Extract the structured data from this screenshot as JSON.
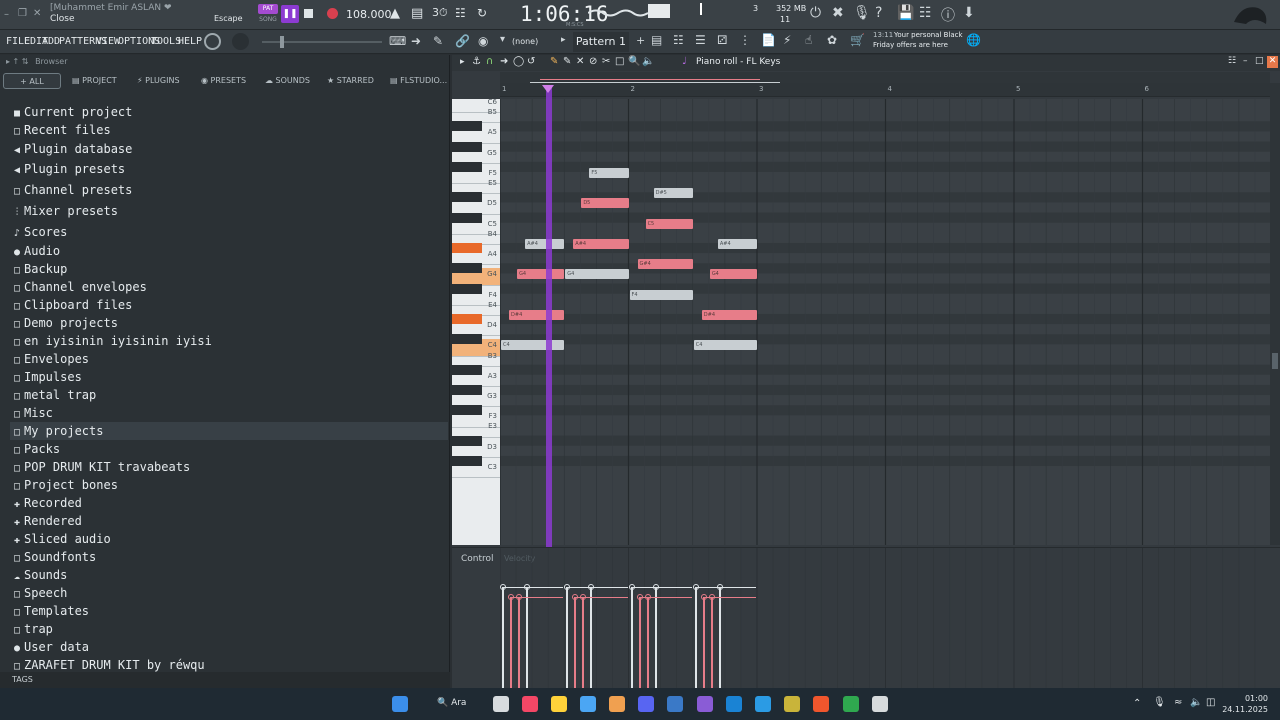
{
  "topbar": {
    "user_title": "[Muhammet Emir ASLAN ❤",
    "close_hint": "Close",
    "escape_hint": "Escape",
    "pat_label": "PAT",
    "song_label": "SONG",
    "tempo": "108.000",
    "time": "1:06:16",
    "time_unit": "M:S:CS",
    "cpu_bars": "3",
    "mem": "352 MB",
    "poly": "11",
    "notification_time": "13:11",
    "notification_text_1": "Your personal Black",
    "notification_text_2": "Friday offers are here"
  },
  "menubar": {
    "items": [
      "FILE",
      "EDIT",
      "ADD",
      "PATTERNS",
      "VIEW",
      "OPTIONS",
      "TOOLS",
      "HELP"
    ],
    "preset": "(none)",
    "pattern": "Pattern 1"
  },
  "browser": {
    "title": "Browser",
    "tabs": [
      "ALL",
      "PROJECT",
      "PLUGINS",
      "PRESETS",
      "SOUNDS",
      "STARRED",
      "FLSTUDIO..."
    ],
    "items": [
      {
        "label": "Current project",
        "icon": "file-icon"
      },
      {
        "label": "Recent files",
        "icon": "folder-icon"
      },
      {
        "label": "Plugin database",
        "icon": "plug-icon"
      },
      {
        "label": "Plugin presets",
        "icon": "plug-icon"
      },
      {
        "label": "Channel presets",
        "icon": "folder-icon"
      },
      {
        "label": "Mixer presets",
        "icon": "sliders-icon"
      },
      {
        "label": "Scores",
        "icon": "note-icon"
      },
      {
        "label": "Audio",
        "icon": "user-icon"
      },
      {
        "label": "Backup",
        "icon": "folder-icon"
      },
      {
        "label": "Channel envelopes",
        "icon": "folder-icon"
      },
      {
        "label": "Clipboard files",
        "icon": "folder-icon"
      },
      {
        "label": "Demo projects",
        "icon": "folder-icon"
      },
      {
        "label": "en iyisinin iyisinin iyisi",
        "icon": "folder-icon"
      },
      {
        "label": "Envelopes",
        "icon": "folder-icon"
      },
      {
        "label": "Impulses",
        "icon": "folder-icon"
      },
      {
        "label": "metal trap",
        "icon": "folder-icon"
      },
      {
        "label": "Misc",
        "icon": "folder-icon"
      },
      {
        "label": "My projects",
        "icon": "folder-icon"
      },
      {
        "label": "Packs",
        "icon": "folder-icon"
      },
      {
        "label": "POP DRUM KIT travabeats",
        "icon": "folder-icon"
      },
      {
        "label": "Project bones",
        "icon": "folder-icon"
      },
      {
        "label": "Recorded",
        "icon": "plus-icon"
      },
      {
        "label": "Rendered",
        "icon": "plus-icon"
      },
      {
        "label": "Sliced audio",
        "icon": "plus-icon"
      },
      {
        "label": "Soundfonts",
        "icon": "folder-icon"
      },
      {
        "label": "Sounds",
        "icon": "cloud-icon"
      },
      {
        "label": "Speech",
        "icon": "folder-icon"
      },
      {
        "label": "Templates",
        "icon": "folder-icon"
      },
      {
        "label": "trap",
        "icon": "folder-icon"
      },
      {
        "label": "User data",
        "icon": "user-icon"
      },
      {
        "label": "ZARAFET DRUM KIT by réwqu",
        "icon": "folder-icon"
      }
    ],
    "tags_label": "TAGS"
  },
  "piano_roll": {
    "title": "Piano roll - FL Keys",
    "bar_numbers": [
      "1",
      "2",
      "3",
      "4",
      "5",
      "6"
    ],
    "key_labels": [
      "C6",
      "B5",
      "A5",
      "G5",
      "F5",
      "E5",
      "D5",
      "C5",
      "B4",
      "A4",
      "G4",
      "F4",
      "E4",
      "D4",
      "C4",
      "B3",
      "A3",
      "G3",
      "F3",
      "E3",
      "D3",
      "C3"
    ],
    "notes": [
      {
        "label": "F5",
        "color": "gray"
      },
      {
        "label": "D#5",
        "color": "gray"
      },
      {
        "label": "D5",
        "color": "pink"
      },
      {
        "label": "C5",
        "color": "pink"
      },
      {
        "label": "A#4",
        "color": "gray"
      },
      {
        "label": "A#4",
        "color": "pink"
      },
      {
        "label": "A#4",
        "color": "gray"
      },
      {
        "label": "G#4",
        "color": "pink"
      },
      {
        "label": "G4",
        "color": "pink"
      },
      {
        "label": "G4",
        "color": "gray"
      },
      {
        "label": "G4",
        "color": "pink"
      },
      {
        "label": "F4",
        "color": "gray"
      },
      {
        "label": "D#4",
        "color": "pink"
      },
      {
        "label": "D#4",
        "color": "pink"
      },
      {
        "label": "C4",
        "color": "gray"
      },
      {
        "label": "C4",
        "color": "gray"
      }
    ],
    "control_label": "Control",
    "control_value": "Velocity"
  },
  "taskbar": {
    "search_label": "Ara",
    "time": "01:00",
    "date": "24.11.2025"
  },
  "colors": {
    "accent_purple": "#8c3bd1",
    "note_pink": "#e77d89",
    "note_gray": "#c8ced2",
    "key_highlight": "#f0a060"
  }
}
